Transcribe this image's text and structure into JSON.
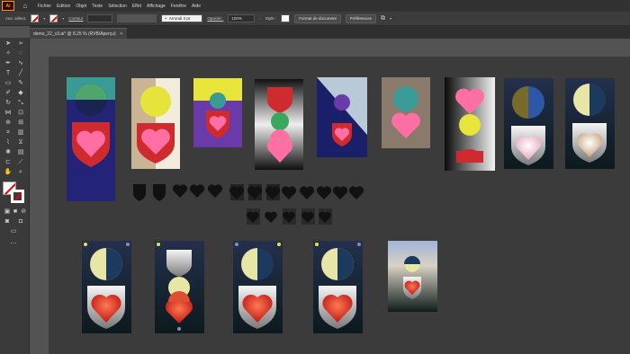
{
  "app": {
    "logo": "Ai",
    "home_icon": "home-icon"
  },
  "menu": [
    "Fichier",
    "Edition",
    "Objet",
    "Texte",
    "Sélection",
    "Effet",
    "Affichage",
    "Fenêtre",
    "Aide"
  ],
  "control": {
    "selection_label": "Auc. sélect.",
    "stroke_label": "Contour",
    "brush_label": "Arrondi 3 pt",
    "opacity_label": "Opacité :",
    "opacity_value": "100%",
    "style_label": "Style :",
    "doc_format_button": "Format de document",
    "prefs_button": "Préférences"
  },
  "tab": {
    "title": "demo_22_v3.ai* @ 8,25 % (RVB/Aperçu)"
  },
  "colors": {
    "accent_red": "#e4252f",
    "canvas": "#535353",
    "artboard": "#3b3b3b"
  }
}
